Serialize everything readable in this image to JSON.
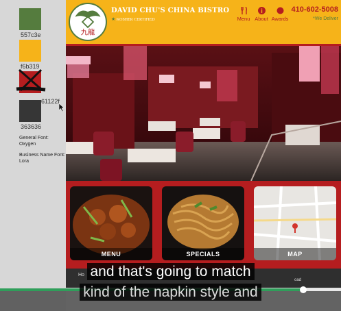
{
  "style_guide": {
    "swatches": [
      {
        "hex_label": "557c3e",
        "color": "#557c3e"
      },
      {
        "hex_label": "f6b319",
        "color": "#f6b319"
      },
      {
        "hex_label": "61122f",
        "color": "#b51d1f"
      },
      {
        "hex_label": "363636",
        "color": "#363636"
      }
    ],
    "general_font_label": "General Font:",
    "general_font_value": "Oxygen",
    "business_font_label": "Business Name Font:",
    "business_font_value": "Lora"
  },
  "site": {
    "business_name": "DAVID CHU'S CHINA BISTRO",
    "tagline_star": "★",
    "tagline": "KOSHER CERTIFIED",
    "logo_text": "九龍",
    "nav": [
      {
        "label": "Menu",
        "icon": "utensils-icon"
      },
      {
        "label": "About",
        "icon": "info-icon"
      },
      {
        "label": "Awards",
        "icon": "circle-icon"
      }
    ],
    "phone": "410-602-5008",
    "deliver": "*We Deliver",
    "tiles": [
      {
        "label": "MENU"
      },
      {
        "label": "SPECIALS"
      },
      {
        "label": "MAP"
      }
    ],
    "footer_left": "Ho",
    "footer_right": "oad"
  },
  "video": {
    "caption_line1": "and that's going to match",
    "caption_line2": "kind of the napkin style and",
    "progress": 0.89
  },
  "colors": {
    "accent_green": "#557c3e",
    "accent_yellow": "#f6b319",
    "accent_red": "#b51d1f",
    "dark": "#363636"
  }
}
